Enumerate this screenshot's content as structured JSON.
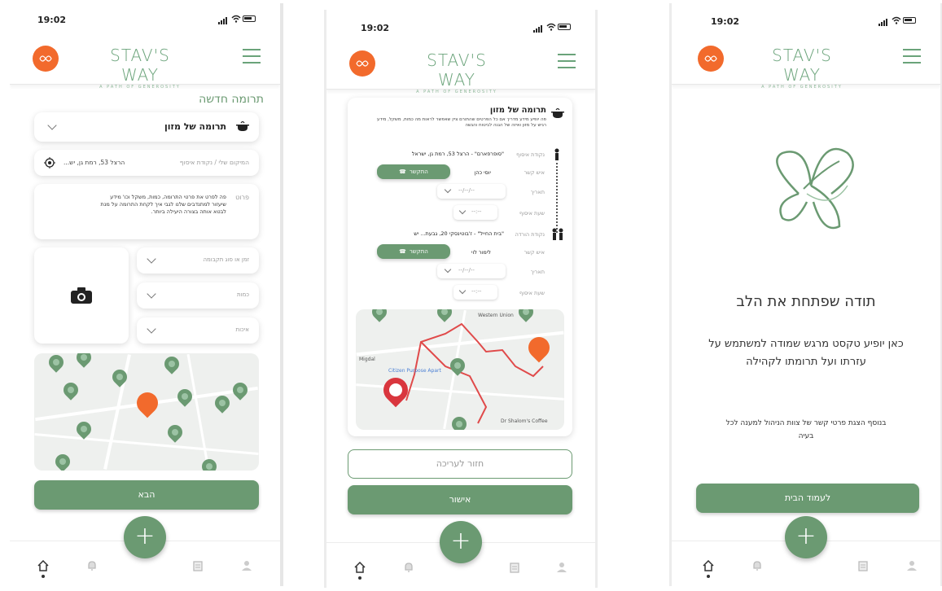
{
  "status": {
    "time": "19:02"
  },
  "brand": {
    "name": "STAV'S WAY",
    "tagline": "A PATH OF GENEROSITY"
  },
  "colors": {
    "accent_green": "#6b9a72",
    "brand_orange": "#f26a2c",
    "light_green": "#9cc3a4"
  },
  "screen1": {
    "title": "תרומה חדשה",
    "category": "תרומה של מזון",
    "location_label": "המיקום שלי / נקודת איסוף",
    "location_value": "הרצל 53, רמת גן, יש...",
    "details_label": "פרוט",
    "details_text": "פה לפרט את פרטי התרומה, כמות, משקל וכו' מידע שיעזור למתנדבים שלנו לגבי איך לקחת התרומה על מנת לבטא אותה בצורה היעילה ביותר.",
    "field_pickup_time": "זמן או סוג תקבומה",
    "field_quantity": "כמות",
    "field_expiry": "איכות",
    "next_button": "הבא"
  },
  "screen2": {
    "title": "תרומה של מזון",
    "description": "פה יופיע מידע מדריך אם כל הפרטים שהתורם ציין שאפשר לראות מה כמות, משקל, מידע רגיש על מזון ואיזה של הגנה לביטוח והגשה",
    "pickup_label": "נקודת איסוף",
    "pickup_value": "\"סופרפארם\" - הרצל 53, רמת גן, ישראל",
    "contact_label": "איש קשר",
    "contact_name": "יוסי כהן",
    "call_button_1": "התקשר",
    "date_label_1": "תאריך",
    "date_value_1": "--/--/--",
    "time_label_1": "שעת איסוף",
    "time_value_1": "--:--",
    "dropoff_label": "נקודת הורדה",
    "dropoff_value": "\"בית החייל\" - ז'בוטינסקי 20, גבעת... יש",
    "contact_label_2": "איש קשר",
    "contact_name_2": "לימור לוי",
    "call_button_2": "התקשר",
    "date_label_2": "תאריך",
    "date_value_2": "--/--/--",
    "time_label_2": "שעת איסוף",
    "time_value_2": "--:--",
    "map_label_a": "Western Union",
    "map_label_b": "Citizen Purpose Apart",
    "map_label_c": "Dr Shalom's Coffee",
    "map_label_d": "Migdal",
    "back_button": "חזור לעריכה",
    "confirm_button": "אישור"
  },
  "screen3": {
    "title": "תודה שפתחת את הלב",
    "body": "כאן יופיע טקסט מרגש שמודה למשתמש על עזרתו ועל תרומתו לקהילה",
    "note": "בנוסף הצגת פרטי קשר של צוות הניהול למענה לכל בעיה",
    "home_button": "לעמוד הבית"
  },
  "nav": {
    "home": "home-icon",
    "notifications": "bell-icon",
    "add": "+",
    "list": "clipboard-icon",
    "profile": "user-icon"
  }
}
